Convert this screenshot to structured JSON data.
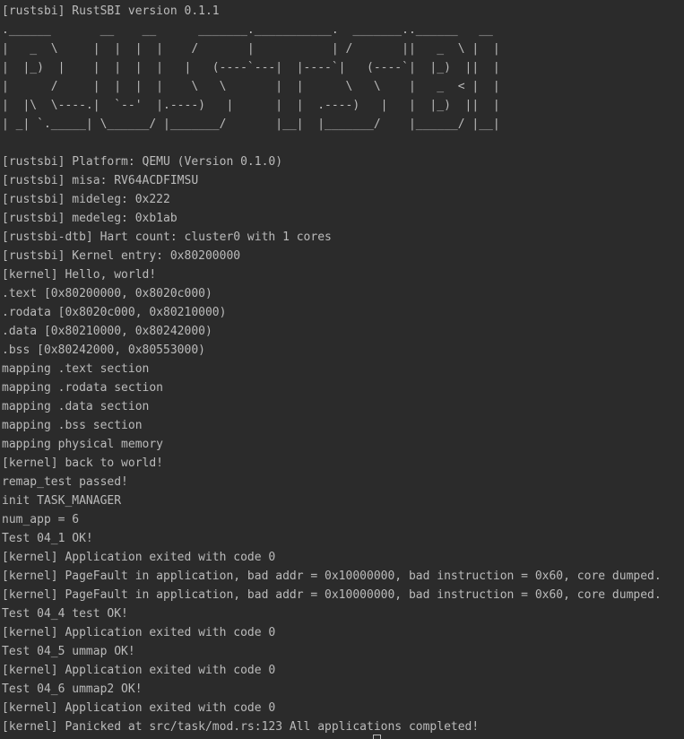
{
  "terminal": {
    "lines": [
      "[rustsbi] RustSBI version 0.1.1",
      ".______       __    __      _______.___________.  _______..______   __",
      "|   _  \\     |  |  |  |    /       |           | /       ||   _  \\ |  |",
      "|  |_)  |    |  |  |  |   |   (----`---|  |----`|   (----`|  |_)  ||  |",
      "|      /     |  |  |  |    \\   \\       |  |      \\   \\    |   _  < |  |",
      "|  |\\  \\----.|  `--'  |.----)   |      |  |  .----)   |   |  |_)  ||  |",
      "| _| `._____| \\______/ |_______/       |__|  |_______/    |______/ |__|",
      "",
      "[rustsbi] Platform: QEMU (Version 0.1.0)",
      "[rustsbi] misa: RV64ACDFIMSU",
      "[rustsbi] mideleg: 0x222",
      "[rustsbi] medeleg: 0xb1ab",
      "[rustsbi-dtb] Hart count: cluster0 with 1 cores",
      "[rustsbi] Kernel entry: 0x80200000",
      "[kernel] Hello, world!",
      ".text [0x80200000, 0x8020c000)",
      ".rodata [0x8020c000, 0x80210000)",
      ".data [0x80210000, 0x80242000)",
      ".bss [0x80242000, 0x80553000)",
      "mapping .text section",
      "mapping .rodata section",
      "mapping .data section",
      "mapping .bss section",
      "mapping physical memory",
      "[kernel] back to world!",
      "remap_test passed!",
      "init TASK_MANAGER",
      "num_app = 6",
      "Test 04_1 OK!",
      "[kernel] Application exited with code 0",
      "[kernel] PageFault in application, bad addr = 0x10000000, bad instruction = 0x60, core dumped.",
      "[kernel] PageFault in application, bad addr = 0x10000000, bad instruction = 0x60, core dumped.",
      "Test 04_4 test OK!",
      "[kernel] Application exited with code 0",
      "Test 04_5 ummap OK!",
      "[kernel] Application exited with code 0",
      "Test 04_6 ummap2 OK!",
      "[kernel] Application exited with code 0",
      "[kernel] Panicked at src/task/mod.rs:123 All applications completed!"
    ]
  },
  "colors": {
    "background": "#2b2b2b",
    "text": "#bbbbbb"
  }
}
